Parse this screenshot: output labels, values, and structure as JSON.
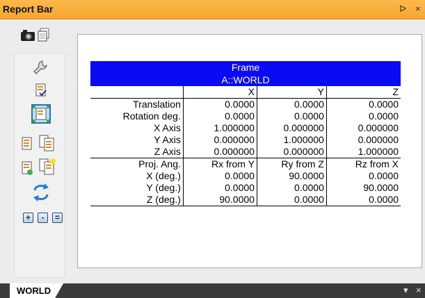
{
  "window": {
    "title": "Report Bar",
    "pin_glyph": "ᐅ",
    "close_glyph": "×"
  },
  "toolbar": {
    "icons": [
      "camera-icon",
      "copy-icon",
      "wrench-icon",
      "document-check-icon",
      "frame-icon",
      "report-icon",
      "report-multi-icon",
      "report-add-icon",
      "report-star-icon",
      "refresh-icon"
    ],
    "buttons": [
      "+",
      "-",
      "="
    ]
  },
  "report": {
    "header_line1": "Frame",
    "header_line2": "A::WORLD",
    "columns": [
      "",
      "X",
      "Y",
      "Z"
    ],
    "rows_top": [
      [
        "Translation",
        "0.0000",
        "0.0000",
        "0.0000"
      ],
      [
        "Rotation deg.",
        "0.0000",
        "0.0000",
        "0.0000"
      ],
      [
        "X Axis",
        "1.000000",
        "0.000000",
        "0.000000"
      ],
      [
        "Y Axis",
        "0.000000",
        "1.000000",
        "0.000000"
      ],
      [
        "Z Axis",
        "0.000000",
        "0.000000",
        "1.000000"
      ]
    ],
    "rows_bottom": [
      [
        "Proj. Ang.",
        "Rx from Y",
        "Ry from Z",
        "Rz from X"
      ],
      [
        "X (deg.)",
        "0.0000",
        "90.0000",
        "0.0000"
      ],
      [
        "Y (deg.)",
        "0.0000",
        "0.0000",
        "90.0000"
      ],
      [
        "Z (deg.)",
        "90.0000",
        "0.0000",
        "0.0000"
      ]
    ]
  },
  "bottom": {
    "tab_label": "WORLD",
    "menu_glyph": "▾",
    "close_glyph": "×"
  }
}
